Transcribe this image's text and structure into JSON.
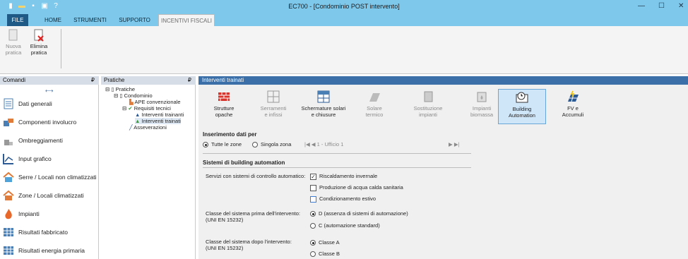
{
  "window": {
    "title": "EC700 - [Condominio POST intervento]",
    "minimize": "—",
    "maximize": "☐",
    "close": "✕"
  },
  "quick_access": {
    "icons": [
      "new-file-icon",
      "open-folder-icon",
      "save-icon",
      "print-icon",
      "help-icon"
    ]
  },
  "ribbon_tabs": [
    {
      "label": "FILE"
    },
    {
      "label": "HOME"
    },
    {
      "label": "STRUMENTI"
    },
    {
      "label": "SUPPORTO"
    },
    {
      "label": "INCENTIVI FISCALI"
    }
  ],
  "ribbon": {
    "new_label": "Nuova\npratica",
    "delete_label": "Elimina\npratica"
  },
  "comandi": {
    "title": "Comandi",
    "pin": "₽"
  },
  "nav": [
    {
      "label": "Dati generali",
      "icon": "document-icon"
    },
    {
      "label": "Componenti involucro",
      "icon": "building-parts-icon"
    },
    {
      "label": "Ombreggiamenti",
      "icon": "shading-icon"
    },
    {
      "label": "Input grafico",
      "icon": "graph-input-icon"
    },
    {
      "label": "Serre / Locali non climatizzati",
      "icon": "house-icon"
    },
    {
      "label": "Zone / Locali climatizzati",
      "icon": "house-heated-icon"
    },
    {
      "label": "Impianti",
      "icon": "flame-icon"
    },
    {
      "label": "Risultati fabbricato",
      "icon": "results-table-icon"
    },
    {
      "label": "Risultati energia primaria",
      "icon": "results-energy-icon"
    }
  ],
  "pratiche": {
    "title": "Pratiche",
    "pin": "₽",
    "tree": [
      "Pratiche",
      "Condominio",
      "APE convenzionale",
      "Requisiti tecnici",
      "Interventi trainanti",
      "Interventi trainati",
      "Asseverazioni"
    ]
  },
  "main": {
    "header": "Interventi trainati",
    "toolbar": [
      {
        "label": "Strutture\nopache",
        "icon": "wall-bricks-icon",
        "enabled": true
      },
      {
        "label": "Serramenti\ne infissi",
        "icon": "window-icon",
        "enabled": false
      },
      {
        "label": "Schermature solari\ne chiusure",
        "icon": "blind-icon",
        "enabled": true
      },
      {
        "label": "Solare\ntermico",
        "icon": "solar-thermal-icon",
        "enabled": false
      },
      {
        "label": "Sostituzione\nimpianti",
        "icon": "boiler-icon",
        "enabled": false
      },
      {
        "label": "Impianti\nbiomassa",
        "icon": "biomass-icon",
        "enabled": false
      },
      {
        "label": "Building\nAutomation",
        "icon": "building-automation-icon",
        "enabled": true,
        "selected": true
      },
      {
        "label": "FV e\nAccumuli",
        "icon": "photovoltaic-icon",
        "enabled": true
      }
    ],
    "inserimento": {
      "title": "Inserimento dati per",
      "opt_all": "Tutte le zone",
      "opt_single": "Singola zona",
      "zone_value": "1 - Ufficio 1"
    },
    "sistemi": {
      "title": "Sistemi di building automation",
      "servizi_label": "Servizi con sistemi di controllo automatico:",
      "servizi": [
        {
          "label": "Riscaldamento invernale",
          "checked": true
        },
        {
          "label": "Produzione di acqua calda sanitaria",
          "checked": false
        },
        {
          "label": "Condizionamento estivo",
          "checked": false
        }
      ],
      "prima_label": "Classe del sistema prima dell'intervento:\n(UNI EN 15232)",
      "prima_opts": [
        {
          "label": "D (assenza di sistemi di automazione)",
          "checked": true
        },
        {
          "label": "C (automazione standard)",
          "checked": false
        }
      ],
      "dopo_label": "Classe del sistema dopo l'intervento:\n(UNI EN 15232)",
      "dopo_opts": [
        {
          "label": "Classe A",
          "checked": true
        },
        {
          "label": "Classe B",
          "checked": false
        }
      ]
    }
  },
  "colors": {
    "titlebar": "#7ec8ec",
    "file_tab": "#1f5a86",
    "header": "#3b6fa8",
    "selected": "#cfe5f8"
  }
}
